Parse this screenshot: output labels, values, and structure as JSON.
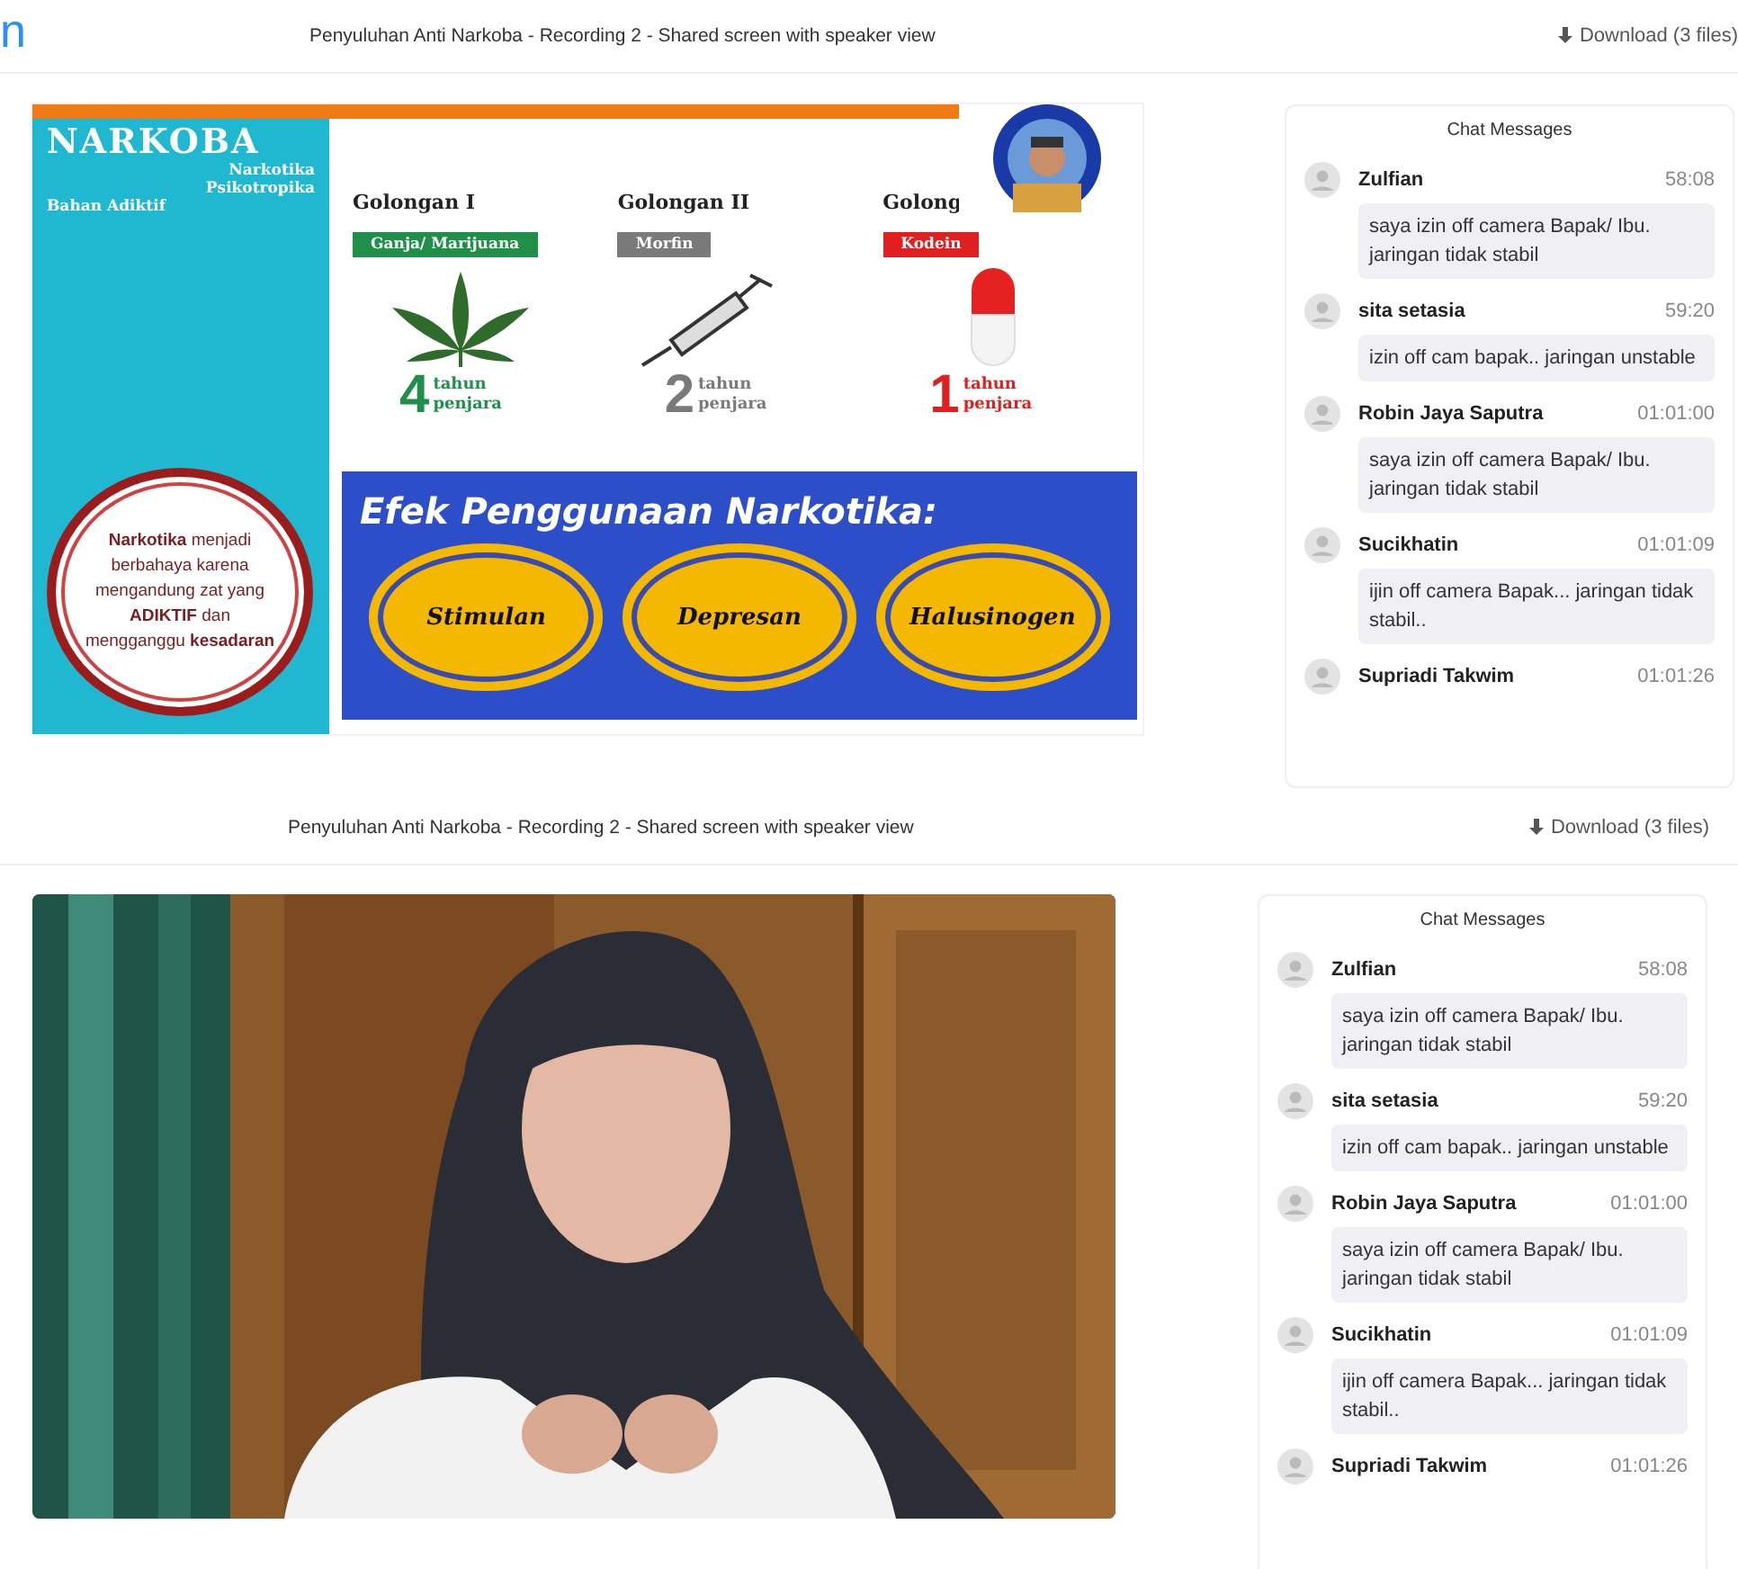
{
  "sections": [
    {
      "logo": "n",
      "title": "Penyuluhan Anti Narkoba - Recording 2 - Shared screen with speaker view",
      "download": "Download (3 files)",
      "media": {
        "kind": "slide",
        "sidebar": {
          "title": "NARKOBA",
          "subtitles": [
            "Narkotika",
            "Psikotropika",
            "Bahan Adiktif"
          ],
          "note": "**Narkotika** menjadi berbahaya karena mengandung zat yang **ADIKTIF** dan mengganggu **kesadaran**"
        },
        "groups": [
          {
            "kind": "leaf",
            "title": "Golongan I",
            "drug": "Ganja/ Marijuana",
            "color": "#1f8f4a",
            "number": "4",
            "unit_top": "tahun",
            "unit_bottom": "penjara"
          },
          {
            "kind": "syringe",
            "title": "Golongan II",
            "drug": "Morfin",
            "color": "#7a7a7a",
            "number": "2",
            "unit_top": "tahun",
            "unit_bottom": "penjara"
          },
          {
            "kind": "capsule",
            "title": "Golong",
            "drug": "Kodein",
            "color": "#e02020",
            "number": "1",
            "unit_top": "tahun",
            "unit_bottom": "penjara"
          }
        ],
        "effects_title": "Efek Penggunaan Narkotika:",
        "effects": [
          "Stimulan",
          "Depresan",
          "Halusinogen"
        ]
      },
      "chat": {
        "title": "Chat Messages",
        "messages": [
          {
            "name": "Zulfian",
            "time": "58:08",
            "text": "saya izin off camera Bapak/ Ibu. jaringan tidak stabil"
          },
          {
            "name": "sita setasia",
            "time": "59:20",
            "text": "izin off cam bapak.. jaringan unstable"
          },
          {
            "name": "Robin Jaya Saputra",
            "time": "01:01:00",
            "text": "saya izin off camera Bapak/ Ibu. jaringan tidak stabil"
          },
          {
            "name": "Sucikhatin",
            "time": "01:01:09",
            "text": "ijin off camera Bapak... jaringan tidak stabil.."
          },
          {
            "name": "Supriadi Takwim",
            "time": "01:01:26"
          }
        ]
      }
    },
    {
      "title": "Penyuluhan Anti Narkoba - Recording 2 - Shared screen with speaker view",
      "download": "Download (3 files)",
      "media": {
        "kind": "video"
      },
      "chat": {
        "title": "Chat Messages",
        "messages": [
          {
            "name": "Zulfian",
            "time": "58:08",
            "text": "saya izin off camera Bapak/ Ibu. jaringan tidak stabil"
          },
          {
            "name": "sita setasia",
            "time": "59:20",
            "text": "izin off cam bapak.. jaringan unstable"
          },
          {
            "name": "Robin Jaya Saputra",
            "time": "01:01:00",
            "text": "saya izin off camera Bapak/ Ibu. jaringan tidak stabil"
          },
          {
            "name": "Sucikhatin",
            "time": "01:01:09",
            "text": "ijin off camera Bapak... jaringan tidak stabil.."
          },
          {
            "name": "Supriadi Takwim",
            "time": "01:01:26"
          }
        ]
      }
    }
  ]
}
